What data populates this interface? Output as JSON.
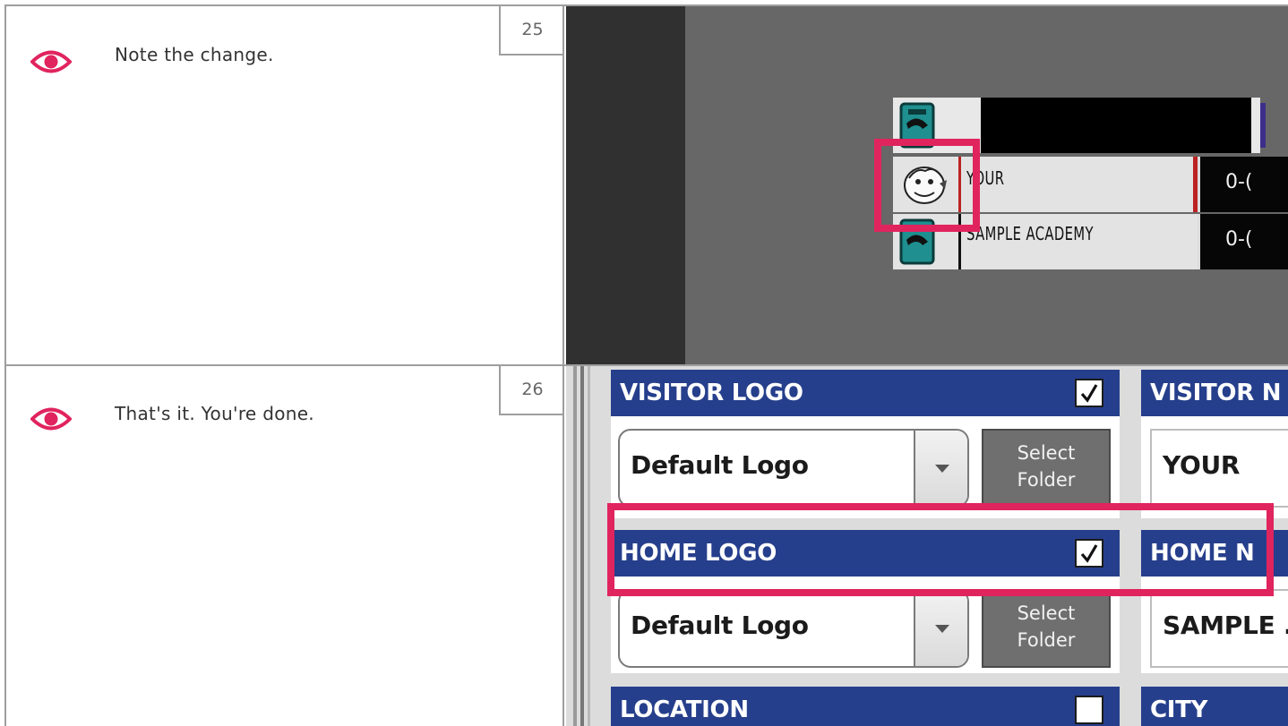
{
  "steps": [
    {
      "number": "25",
      "instruction": "Note the change.",
      "icon": "eye-icon"
    },
    {
      "number": "26",
      "instruction": "That's it. You're done.",
      "icon": "eye-icon"
    }
  ],
  "scoreboard": {
    "rows": [
      {
        "team": "YOUR",
        "record": "0-("
      },
      {
        "team": "SAMPLE ACADEMY",
        "record": "0-("
      }
    ]
  },
  "settings": {
    "visitor_logo": {
      "title": "VISITOR LOGO",
      "checked": true,
      "selected": "Default Logo",
      "folder_line1": "Select",
      "folder_line2": "Folder"
    },
    "visitor_name": {
      "title": "VISITOR N",
      "value": "YOUR"
    },
    "home_logo": {
      "title": "HOME LOGO",
      "checked": true,
      "selected": "Default Logo",
      "folder_line1": "Select",
      "folder_line2": "Folder"
    },
    "home_name": {
      "title": "HOME N",
      "value": "SAMPLE ."
    },
    "location": {
      "title": "LOCATION",
      "checked": false
    },
    "city": {
      "title": "CITY"
    }
  },
  "colors": {
    "highlight": "#e0245e",
    "panel_header": "#263f8c",
    "accent_eye": "#e0245e"
  }
}
